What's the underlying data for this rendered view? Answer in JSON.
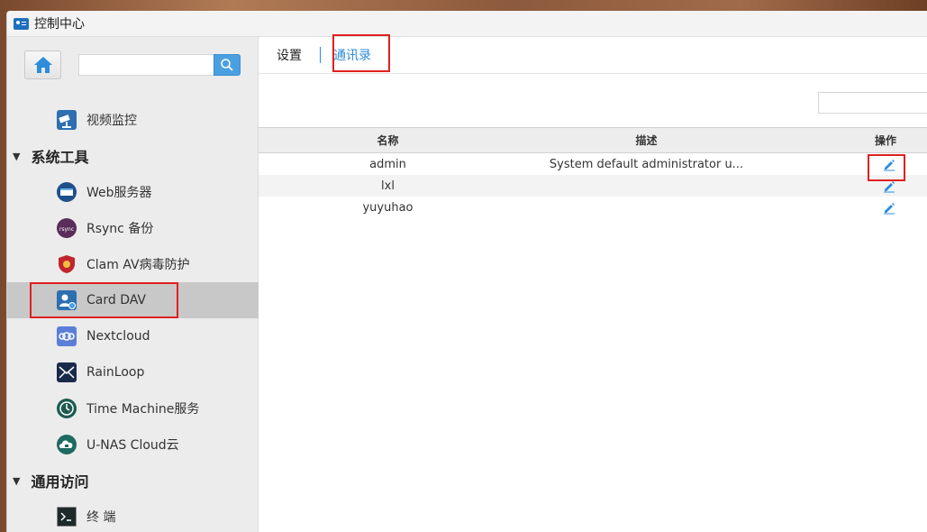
{
  "window": {
    "title": "控制中心"
  },
  "sidebar": {
    "search": {
      "value": "",
      "placeholder": ""
    },
    "items": [
      {
        "id": "video",
        "label": "视频监控",
        "icon": "camera-icon"
      },
      {
        "id": "sec_tools",
        "label": "系统工具",
        "type": "section"
      },
      {
        "id": "web",
        "label": "Web服务器",
        "icon": "web-server-icon"
      },
      {
        "id": "rsync",
        "label": "Rsync 备份",
        "icon": "rsync-icon"
      },
      {
        "id": "clam",
        "label": "Clam AV病毒防护",
        "icon": "shield-icon"
      },
      {
        "id": "carddav",
        "label": "Card DAV",
        "icon": "contact-card-icon",
        "selected": true
      },
      {
        "id": "nextcloud",
        "label": "Nextcloud",
        "icon": "nextcloud-icon"
      },
      {
        "id": "rainloop",
        "label": "RainLoop",
        "icon": "rainloop-icon"
      },
      {
        "id": "timemachine",
        "label": "Time Machine服务",
        "icon": "clock-icon"
      },
      {
        "id": "unas",
        "label": "U-NAS Cloud云",
        "icon": "cloud-lock-icon"
      },
      {
        "id": "sec_access",
        "label": "通用访问",
        "type": "section"
      },
      {
        "id": "terminal",
        "label": "终 端",
        "icon": "terminal-icon"
      }
    ]
  },
  "main": {
    "tabs": [
      {
        "label": "设置",
        "active": false
      },
      {
        "label": "通讯录",
        "active": true
      }
    ],
    "table": {
      "headers": [
        "名称",
        "描述",
        "操作"
      ],
      "rows": [
        {
          "name": "admin",
          "desc": "System default administrator u..."
        },
        {
          "name": "lxl",
          "desc": ""
        },
        {
          "name": "yuyuhao",
          "desc": ""
        }
      ]
    }
  },
  "colors": {
    "accent": "#2d8cdb",
    "highlight": "#e02020"
  }
}
